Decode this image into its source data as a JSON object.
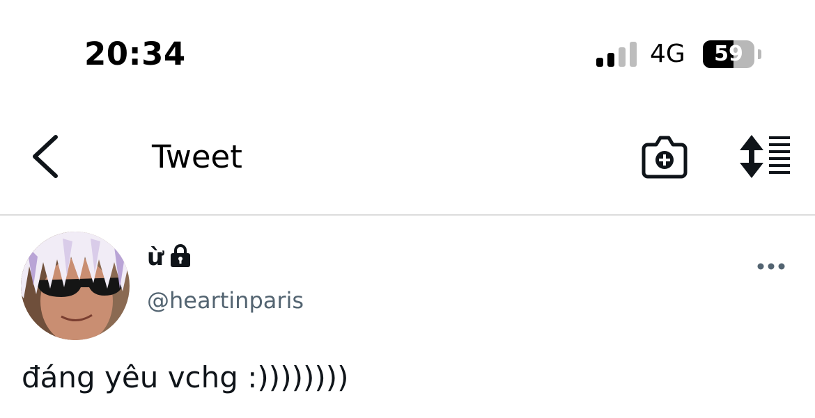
{
  "status_bar": {
    "time": "20:34",
    "network": "4G",
    "battery_level": "59",
    "battery_fraction": 0.59,
    "signal_bars_active": 2,
    "signal_bars_total": 4
  },
  "nav": {
    "title": "Tweet",
    "icons": {
      "back": "chevron-left-icon",
      "camera": "camera-add-icon",
      "sort": "sort-list-icon"
    }
  },
  "tweet": {
    "display_name": "ừ",
    "handle": "@heartinparis",
    "text": "đáng yêu vchg :))))))))",
    "icons": {
      "locked": "lock-icon",
      "more": "more-options-icon",
      "avatar": "avatar-photo"
    }
  },
  "colors": {
    "text_primary": "#0f1419",
    "text_secondary": "#536471",
    "divider": "#dcdcdc",
    "battery_empty": "#b8b8b8"
  }
}
